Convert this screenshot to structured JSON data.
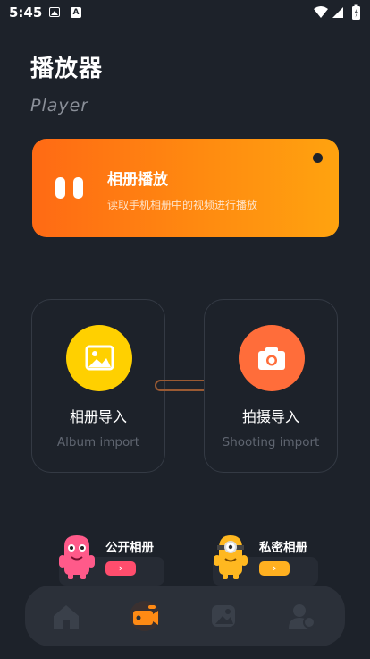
{
  "status_bar": {
    "time": "5:45",
    "a_label": "A"
  },
  "header": {
    "title": "播放器",
    "subtitle": "Player"
  },
  "banner": {
    "title": "相册播放",
    "subtitle": "读取手机相册中的视频进行播放"
  },
  "cards": [
    {
      "label": "相册导入",
      "sublabel": "Album import"
    },
    {
      "label": "拍摄导入",
      "sublabel": "Shooting import"
    }
  ],
  "albums": [
    {
      "label": "公开相册",
      "button": "›",
      "color": "#ff4d6d"
    },
    {
      "label": "私密相册",
      "button": "›",
      "color": "#ffb020"
    }
  ],
  "nav": {
    "items": [
      "home-icon",
      "video-icon",
      "gallery-icon",
      "profile-icon"
    ],
    "active": 1
  },
  "colors": {
    "background": "#1d222a",
    "accent": "#ff7a12",
    "album_yellow": "#ffd000",
    "camera_orange": "#ff6d3a"
  }
}
